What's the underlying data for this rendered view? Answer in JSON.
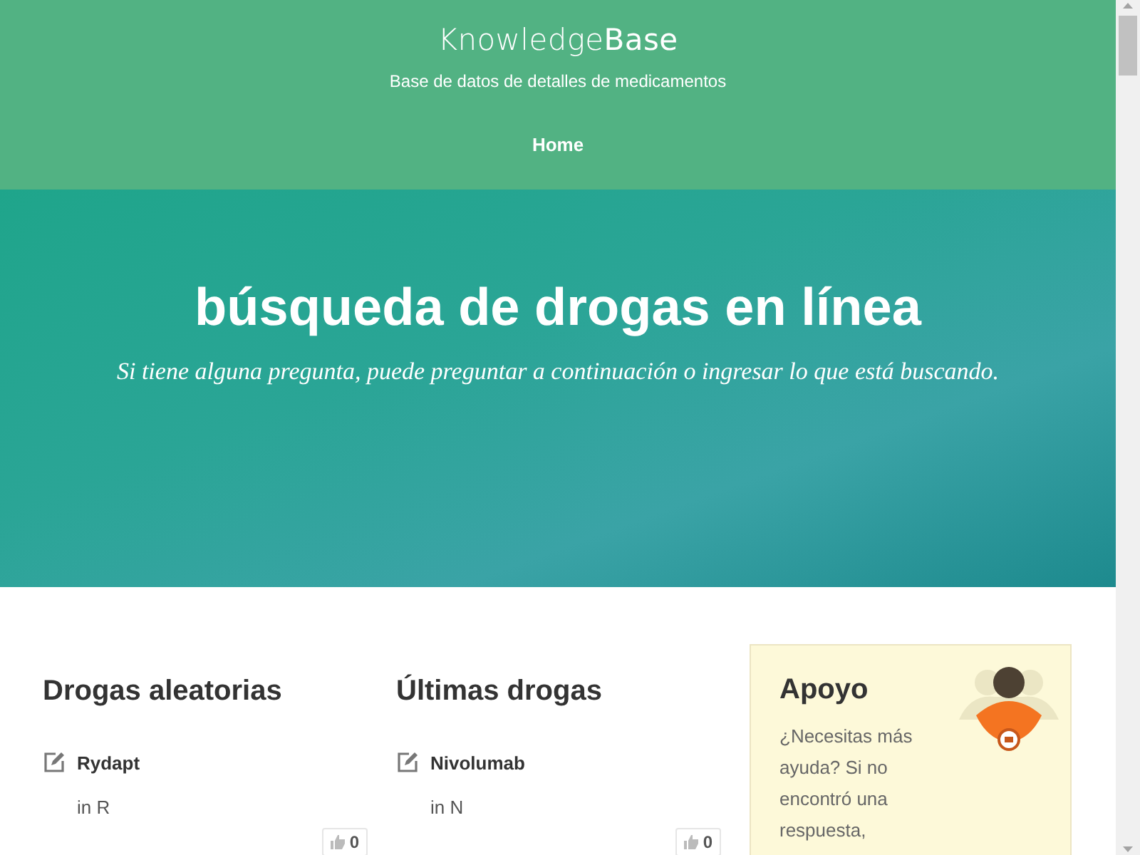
{
  "header": {
    "logo": "Knowledge**Base**",
    "tagline": "Base de datos de detalles de medicamentos",
    "nav": [
      {
        "label": "Home",
        "selected": true
      }
    ]
  },
  "hero": {
    "title": "búsqueda de drogas en línea",
    "subtitle": "Si tiene alguna pregunta, puede preguntar a continuación o ingresar lo que está buscando."
  },
  "sections": [
    {
      "title": "Drogas aleatorias",
      "items": [
        {
          "name": "Rydapt",
          "category": "in R",
          "likes": "0"
        }
      ]
    },
    {
      "title": "Últimas drogas",
      "items": [
        {
          "name": "Nivolumab",
          "category": "in N",
          "likes": "0"
        }
      ]
    }
  ],
  "support": {
    "title": "Apoyo",
    "text": "¿Necesitas más ayuda? Si no encontró una respuesta,"
  }
}
